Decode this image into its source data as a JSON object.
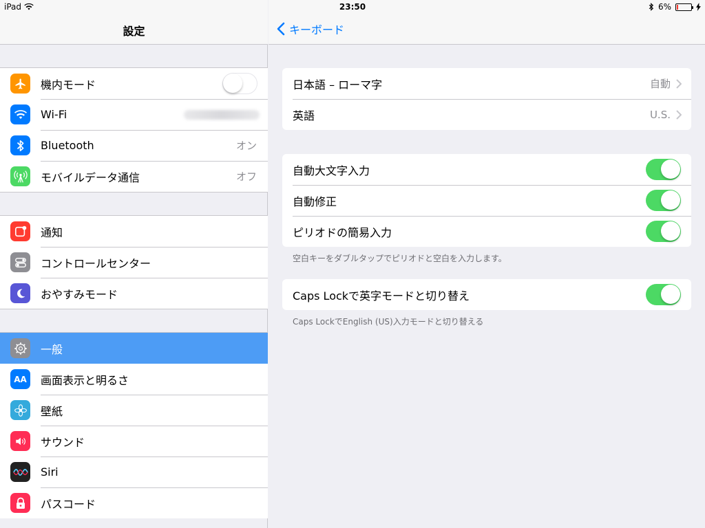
{
  "status": {
    "device": "iPad",
    "time": "23:50",
    "battery_pct": "6%",
    "battery_level": 0.06,
    "icons": [
      "wifi-icon",
      "bluetooth-icon",
      "battery-icon",
      "charging-icon"
    ]
  },
  "left": {
    "title": "設定",
    "group1": [
      {
        "label": "機内モード",
        "icon": "airplane-icon",
        "color": "#ff9500",
        "toggle": false
      },
      {
        "label": "Wi-Fi",
        "icon": "wifi-icon",
        "color": "#007aff"
      },
      {
        "label": "Bluetooth",
        "icon": "bluetooth-icon",
        "color": "#007aff",
        "value": "オン"
      },
      {
        "label": "モバイルデータ通信",
        "icon": "antenna-icon",
        "color": "#4cd964",
        "value": "オフ"
      }
    ],
    "group2": [
      {
        "label": "通知",
        "icon": "notification-icon",
        "color": "#ff3b30"
      },
      {
        "label": "コントロールセンター",
        "icon": "control-center-icon",
        "color": "#8e8e93"
      },
      {
        "label": "おやすみモード",
        "icon": "moon-icon",
        "color": "#5856d6"
      }
    ],
    "group3": [
      {
        "label": "一般",
        "icon": "gear-icon",
        "color": "#8e8e93",
        "selected": true
      },
      {
        "label": "画面表示と明るさ",
        "icon": "display-icon",
        "color": "#007aff",
        "glyph": "AA"
      },
      {
        "label": "壁紙",
        "icon": "wallpaper-icon",
        "color": "#34aadc"
      },
      {
        "label": "サウンド",
        "icon": "speaker-icon",
        "color": "#ff2d55"
      },
      {
        "label": "Siri",
        "icon": "siri-icon",
        "color": "#222"
      },
      {
        "label": "パスコード",
        "icon": "lock-icon",
        "color": "#ff2d55"
      }
    ]
  },
  "right": {
    "back_label": "キーボード",
    "group1": [
      {
        "label": "日本語 – ローマ字",
        "value": "自動"
      },
      {
        "label": "英語",
        "value": "U.S."
      }
    ],
    "group2": [
      {
        "label": "自動大文字入力",
        "toggle": true
      },
      {
        "label": "自動修正",
        "toggle": true
      },
      {
        "label": "ピリオドの簡易入力",
        "toggle": true
      }
    ],
    "footer1": "空白キーをダブルタップでピリオドと空白を入力します。",
    "group3": [
      {
        "label": "Caps Lockで英字モードと切り替え",
        "toggle": true
      }
    ],
    "footer2": "Caps LockでEnglish (US)入力モードと切り替える"
  }
}
